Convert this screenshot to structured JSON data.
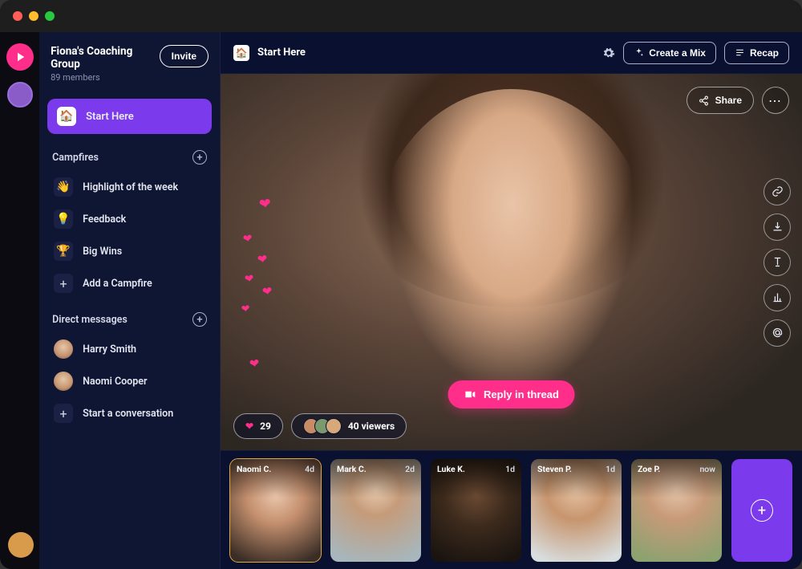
{
  "group": {
    "title": "Fiona's Coaching Group",
    "members": "89 members",
    "invite": "Invite"
  },
  "nav": {
    "start": "Start Here"
  },
  "campfires": {
    "heading": "Campfires",
    "items": [
      {
        "icon": "👋",
        "label": "Highlight of the week"
      },
      {
        "icon": "💡",
        "label": "Feedback"
      },
      {
        "icon": "🏆",
        "label": "Big Wins"
      }
    ],
    "add": "Add a Campfire"
  },
  "dm": {
    "heading": "Direct messages",
    "items": [
      {
        "label": "Harry Smith"
      },
      {
        "label": "Naomi Cooper"
      }
    ],
    "add": "Start a conversation"
  },
  "topbar": {
    "title": "Start Here",
    "create_mix": "Create a Mix",
    "recap": "Recap"
  },
  "stage": {
    "share": "Share",
    "reply": "Reply in thread",
    "likes": "29",
    "viewers": "40 viewers"
  },
  "strip": {
    "cards": [
      {
        "name": "Naomi C.",
        "time": "4d"
      },
      {
        "name": "Mark C.",
        "time": "2d"
      },
      {
        "name": "Luke K.",
        "time": "1d"
      },
      {
        "name": "Steven P.",
        "time": "1d"
      },
      {
        "name": "Zoe P.",
        "time": "now"
      }
    ]
  }
}
